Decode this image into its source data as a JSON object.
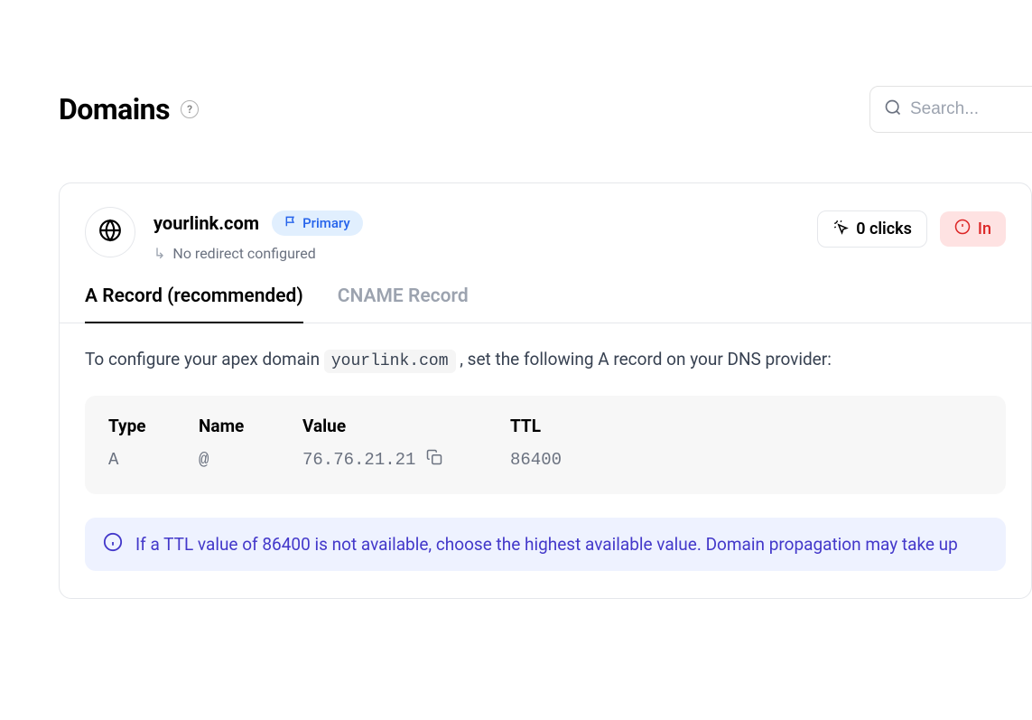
{
  "header": {
    "title": "Domains",
    "search_placeholder": "Search..."
  },
  "domain": {
    "name": "yourlink.com",
    "primary_label": "Primary",
    "redirect_text": "No redirect configured",
    "clicks_label": "0 clicks",
    "status_label": "In"
  },
  "tabs": {
    "a_record": "A Record (recommended)",
    "cname_record": "CNAME Record"
  },
  "instruction": {
    "prefix": "To configure your apex domain ",
    "domain_code": "yourlink.com",
    "suffix": ", set the following A record on your DNS provider:"
  },
  "dns_table": {
    "headers": {
      "type": "Type",
      "name": "Name",
      "value": "Value",
      "ttl": "TTL"
    },
    "row": {
      "type": "A",
      "name": "@",
      "value": "76.76.21.21",
      "ttl": "86400"
    }
  },
  "info_banner": {
    "text": "If a TTL value of 86400 is not available, choose the highest available value. Domain propagation may take up"
  }
}
